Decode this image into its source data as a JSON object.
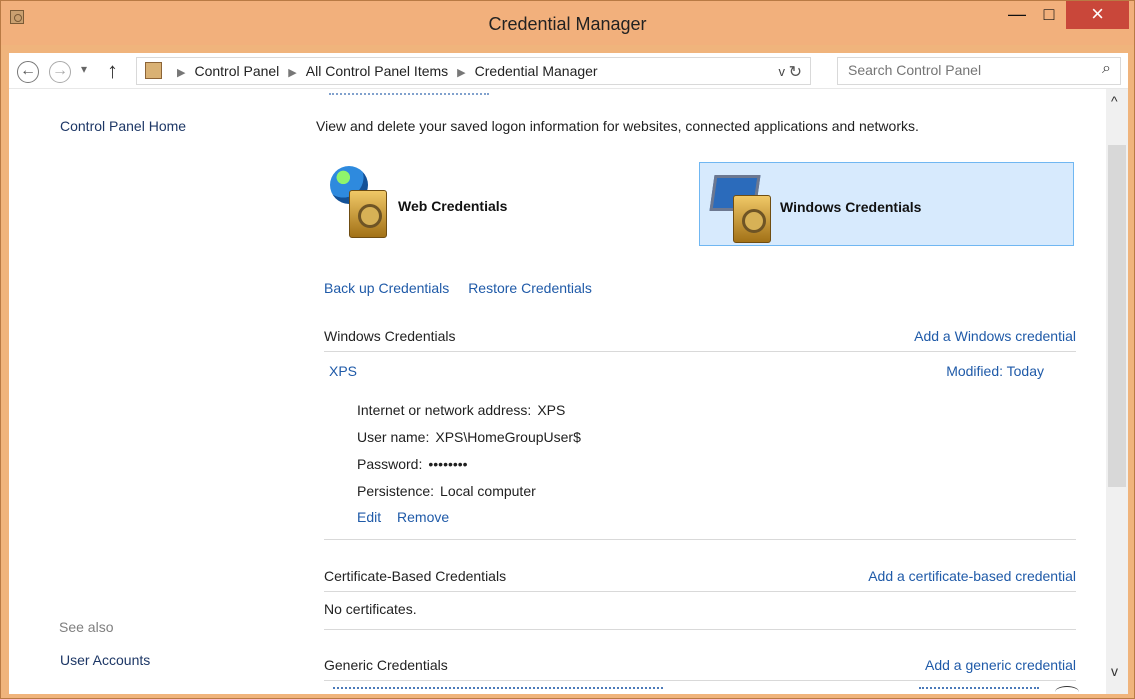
{
  "window": {
    "title": "Credential Manager",
    "minimize": "—",
    "maximize": "□",
    "close": "×"
  },
  "nav": {
    "back": "←",
    "forward": "→",
    "history_dropdown": "▾",
    "up": "↑",
    "breadcrumbs": [
      "Control Panel",
      "All Control Panel Items",
      "Credential Manager"
    ],
    "address_dropdown": "v",
    "refresh": "↻",
    "search_placeholder": "Search Control Panel",
    "search_icon": "⌕"
  },
  "sidebar": {
    "home": "Control Panel Home",
    "see_also": "See also",
    "user_accounts": "User Accounts"
  },
  "main": {
    "intro": "View and delete your saved logon information for websites, connected applications and networks.",
    "tiles": [
      {
        "label": "Web Credentials"
      },
      {
        "label": "Windows Credentials"
      }
    ],
    "backup": "Back up Credentials",
    "restore": "Restore Credentials",
    "windows_section": "Windows Credentials",
    "add_windows": "Add a Windows credential",
    "credential": {
      "name": "XPS",
      "modified_label": "Modified:",
      "modified_value": "Today",
      "collapse": "^",
      "address_label": "Internet or network address:",
      "address_value": "XPS",
      "user_label": "User name:",
      "user_value": "XPS\\HomeGroupUser$",
      "password_label": "Password:",
      "password_value": "••••••••",
      "persistence_label": "Persistence:",
      "persistence_value": "Local computer",
      "edit": "Edit",
      "remove": "Remove"
    },
    "cert_section": "Certificate-Based Credentials",
    "add_cert": "Add a certificate-based credential",
    "no_certificates": "No certificates.",
    "generic_section": "Generic Credentials",
    "add_generic": "Add a generic credential"
  },
  "scrollbar": {
    "up": "^",
    "down": "v"
  }
}
